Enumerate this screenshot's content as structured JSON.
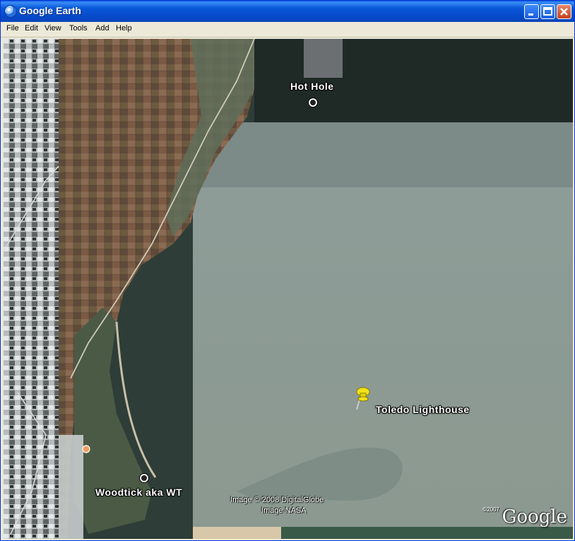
{
  "window": {
    "title": "Google Earth"
  },
  "menu": [
    "File",
    "Edit",
    "View",
    "Tools",
    "Add",
    "Help"
  ],
  "placemarks": {
    "hot_hole": "Hot Hole",
    "toledo_lighthouse": "Toledo Lighthouse",
    "woodtick": "Woodtick aka WT"
  },
  "credits": {
    "imagery_line1": "Image © 2008 DigitalGlobe",
    "imagery_line2": "Image NASA"
  },
  "logo": {
    "copyright": "©2007",
    "text": "Google"
  },
  "colors": {
    "titlebar": "#0a58d8",
    "lake_light": "#8a9a96",
    "lake_dark": "#2f3d38",
    "farmland": "#7a5a45",
    "pushpin": "#f2e31a"
  },
  "icons": [
    "google-earth-app-icon",
    "minimize-icon",
    "maximize-icon",
    "close-icon",
    "yellow-pushpin-icon",
    "placemark-circle-icon"
  ]
}
